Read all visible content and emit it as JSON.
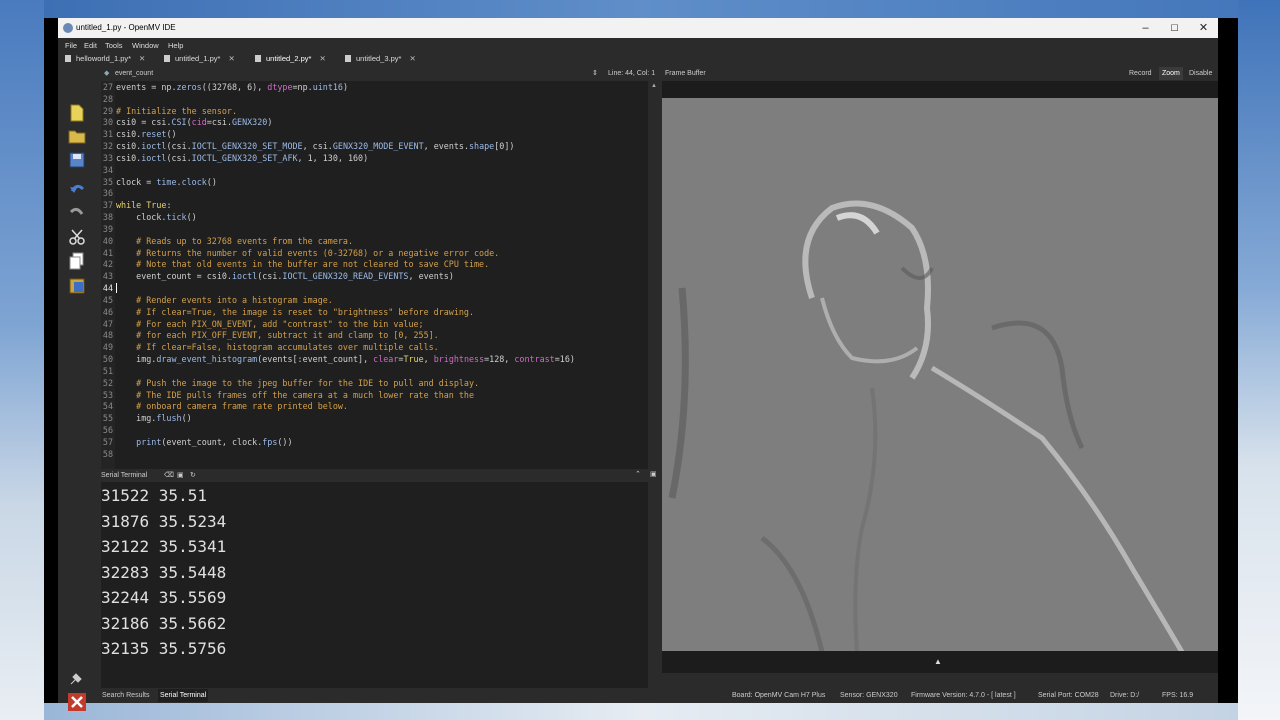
{
  "window": {
    "title": "untitled_1.py - OpenMV IDE",
    "controls": [
      "–",
      "☐",
      "✕"
    ]
  },
  "menu": [
    "File",
    "Edit",
    "Tools",
    "Window",
    "Help"
  ],
  "file_tabs": [
    "helloworld_1.py*",
    "untitled_1.py*",
    "untitled_2.py*",
    "untitled_3.py*"
  ],
  "toolbar_icons": [
    "new-file-icon",
    "open-folder-icon",
    "save-icon",
    "undo-icon",
    "redo-icon",
    "cut-icon",
    "copy-icon",
    "paste-icon"
  ],
  "editor": {
    "function_selector": "event_count",
    "position": "Line: 44, Col: 1",
    "lines": [
      {
        "n": "27",
        "html": "events = np.<f>zeros</f>((32768, 6), <k>dtype</k>=np.<f>uint16</f>)"
      },
      {
        "n": "28",
        "html": ""
      },
      {
        "n": "29",
        "html": "<c># Initialize the sensor.</c>"
      },
      {
        "n": "30",
        "html": "csi0 = csi.<f>CSI</f>(<k>cid</k>=csi.<f>GENX320</f>)"
      },
      {
        "n": "31",
        "html": "csi0.<f>reset</f>()"
      },
      {
        "n": "32",
        "html": "csi0.<f>ioctl</f>(csi.<f>IOCTL_GENX320_SET_MODE</f>, csi.<f>GENX320_MODE_EVENT</f>, events.<f>shape</f>[0])"
      },
      {
        "n": "33",
        "html": "csi0.<f>ioctl</f>(csi.<f>IOCTL_GENX320_SET_AFK</f>, 1, 130, 160)"
      },
      {
        "n": "34",
        "html": ""
      },
      {
        "n": "35",
        "html": "clock = <f>time</f>.<f>clock</f>()"
      },
      {
        "n": "36",
        "html": ""
      },
      {
        "n": "37",
        "html": "<w>while</w> <w>True</w>:"
      },
      {
        "n": "38",
        "html": "    clock.<f>tick</f>()"
      },
      {
        "n": "39",
        "html": ""
      },
      {
        "n": "40",
        "html": "    <c># Reads up to 32768 events from the camera.</c>"
      },
      {
        "n": "41",
        "html": "    <c># Returns the number of valid events (0-32768) or a negative error code.</c>"
      },
      {
        "n": "42",
        "html": "    <c># Note that old events in the buffer are not cleared to save CPU time.</c>"
      },
      {
        "n": "43",
        "html": "    event_count = csi0.<f>ioctl</f>(csi.<f>IOCTL_GENX320_READ_EVENTS</f>, events)"
      },
      {
        "n": "44",
        "html": "<cur></cur>"
      },
      {
        "n": "45",
        "html": "    <c># Render events into a histogram image.</c>"
      },
      {
        "n": "46",
        "html": "    <c># If clear=True, the image is reset to \"brightness\" before drawing.</c>"
      },
      {
        "n": "47",
        "html": "    <c># For each PIX_ON_EVENT, add \"contrast\" to the bin value;</c>"
      },
      {
        "n": "48",
        "html": "    <c># for each PIX_OFF_EVENT, subtract it and clamp to [0, 255].</c>"
      },
      {
        "n": "49",
        "html": "    <c># If clear=False, histogram accumulates over multiple calls.</c>"
      },
      {
        "n": "50",
        "html": "    img.<f>draw_event_histogram</f>(events[:event_count], <k>clear</k>=<w>True</w>, <k>brightness</k>=128, <k>contrast</k>=16)"
      },
      {
        "n": "51",
        "html": ""
      },
      {
        "n": "52",
        "html": "    <c># Push the image to the jpeg buffer for the IDE to pull and display.</c>"
      },
      {
        "n": "53",
        "html": "    <c># The IDE pulls frames off the camera at a much lower rate than the</c>"
      },
      {
        "n": "54",
        "html": "    <c># onboard camera frame rate printed below.</c>"
      },
      {
        "n": "55",
        "html": "    img.<f>flush</f>()"
      },
      {
        "n": "56",
        "html": ""
      },
      {
        "n": "57",
        "html": "    <f>print</f>(event_count, clock.<f>fps</f>())"
      },
      {
        "n": "58",
        "html": ""
      }
    ]
  },
  "serial_terminal": {
    "title": "Serial Terminal",
    "lines": [
      "31522 35.51",
      "31876 35.5234",
      "32122 35.5341",
      "32283 35.5448",
      "32244 35.5569",
      "32186 35.5662",
      "32135 35.5756"
    ]
  },
  "bottom_tabs": [
    "Search Results",
    "Serial Terminal"
  ],
  "frame_buffer": {
    "title": "Frame Buffer",
    "buttons": [
      "Record",
      "Zoom",
      "Disable"
    ]
  },
  "statusbar": {
    "board": "Board: OpenMV Cam H7 Plus",
    "sensor": "Sensor: GENX320",
    "firmware": "Firmware Version: 4.7.0 - [ latest ]",
    "port": "Serial Port: COM28",
    "drive": "Drive: D:/",
    "fps": "FPS: 16.9"
  }
}
